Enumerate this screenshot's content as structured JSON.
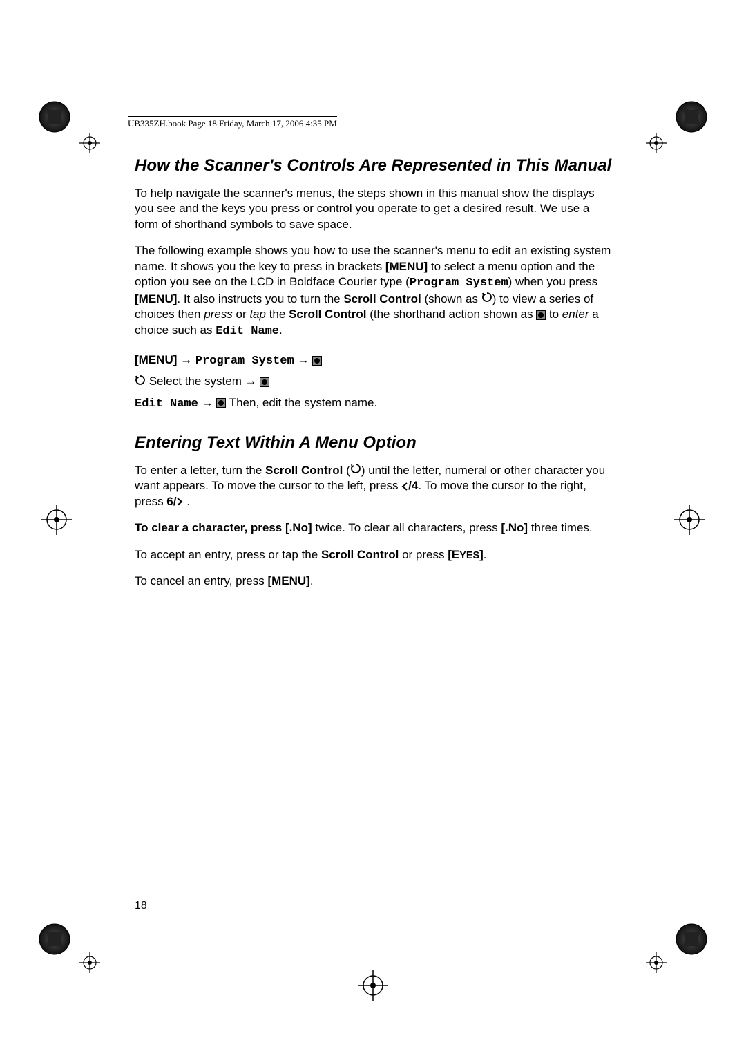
{
  "header": {
    "text": "UB335ZH.book  Page 18  Friday, March 17, 2006  4:35 PM"
  },
  "section1": {
    "heading": "How the Scanner's Controls Are Represented in This Manual",
    "para1_a": "To help navigate the scanner's menus, the steps shown in this manual show the displays you see and the keys you press or control you operate to get a desired result. We use a form of shorthand symbols to save space.",
    "para2_a": "The following example shows you how to use the scanner's menu to edit an existing system name. It shows you the key to press in brackets ",
    "para2_menu": "[MENU]",
    "para2_b": " to select a menu option and the option you see on the LCD in Boldface Courier type (",
    "para2_mono1": "Program System",
    "para2_c": ") when you press ",
    "para2_menu2": "[MENU]",
    "para2_d": ". It also instructs you to turn the ",
    "para2_scroll1": "Scroll Control",
    "para2_e": " (shown as ",
    "para2_f": ") to view a series of choices then ",
    "para2_press": "press",
    "para2_g": " or ",
    "para2_tap": "tap",
    "para2_h": " the ",
    "para2_scroll2": "Scroll Control",
    "para2_i": " (the shorthand action shown as ",
    "para2_j": " to ",
    "para2_enter": "enter",
    "para2_k": " a choice such as ",
    "para2_mono2": "Edit Name",
    "para2_l": ".",
    "step1_menu": "[MENU] ",
    "step1_mono": "Program System",
    "step2_text": " Select the system ",
    "step3_mono": "Edit Name",
    "step3_text": " Then, edit the system name."
  },
  "section2": {
    "heading": "Entering Text Within A Menu Option",
    "para1_a": "To enter a letter, turn the ",
    "para1_scroll": "Scroll Control",
    "para1_b": " (",
    "para1_c": ") until the letter, numeral or other character you want appears. To move the cursor to the left, press ",
    "para1_key1": "/4",
    "para1_d": ". To move the cursor to the right, press ",
    "para1_key2": "6/",
    "para1_e": " .",
    "para2_a": "To clear a character, press [.No]",
    "para2_b": " twice. To clear all characters, press ",
    "para2_no": "[.No]",
    "para2_c": " three times.",
    "para3_a": "To accept an entry, press or tap the ",
    "para3_scroll": "Scroll Control",
    "para3_b": " or press ",
    "para3_eyes": "[EYES]",
    "para3_c": ".",
    "para4_a": "To cancel an entry, press ",
    "para4_menu": "[MENU]",
    "para4_b": "."
  },
  "pageNumber": "18"
}
